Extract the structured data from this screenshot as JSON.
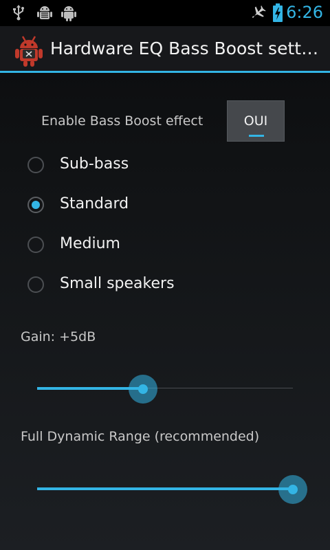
{
  "status_bar": {
    "time": "6:26",
    "time_color": "#33b5e5",
    "left_icons": [
      "usb-icon",
      "android-debug-icon",
      "android-icon"
    ],
    "right_icons": [
      "airplane-mode-icon",
      "battery-charging-icon"
    ]
  },
  "action_bar": {
    "title": "Hardware EQ Bass Boost settings",
    "app_icon": "red-android-app-icon",
    "accent_color": "#33b5e5"
  },
  "bass_boost_switch": {
    "label": "Enable Bass Boost effect",
    "state_text": "OUI",
    "on": true
  },
  "modes": {
    "selected_index": 1,
    "options": [
      {
        "label": "Sub-bass"
      },
      {
        "label": "Standard"
      },
      {
        "label": "Medium"
      },
      {
        "label": "Small speakers"
      }
    ]
  },
  "gain": {
    "label": "Gain: +5dB",
    "fraction": 0.415
  },
  "dynamic_range": {
    "label": "Full Dynamic Range (recommended)",
    "fraction": 1.0
  }
}
